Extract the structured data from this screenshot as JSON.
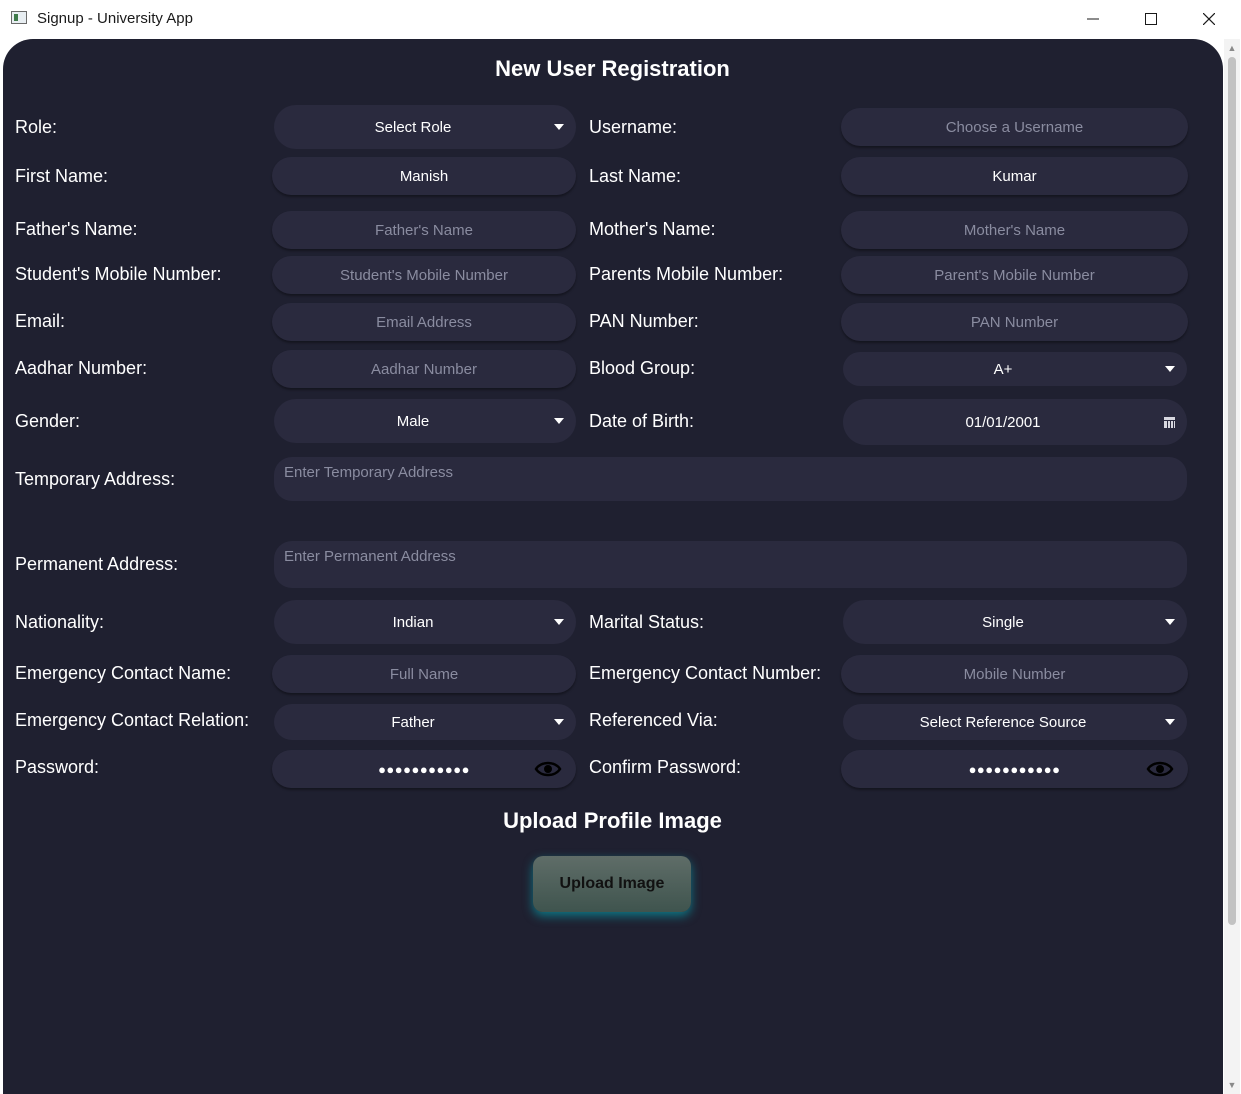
{
  "window": {
    "title": "Signup - University App"
  },
  "form": {
    "heading": "New User Registration",
    "role": {
      "label": "Role:",
      "value": "Select Role"
    },
    "username": {
      "label": "Username:",
      "placeholder": "Choose a Username"
    },
    "first_name": {
      "label": "First Name:",
      "value": "Manish"
    },
    "last_name": {
      "label": "Last Name:",
      "value": "Kumar"
    },
    "father_name": {
      "label": "Father's Name:",
      "placeholder": "Father's Name"
    },
    "mother_name": {
      "label": "Mother's Name:",
      "placeholder": "Mother's Name"
    },
    "student_mobile": {
      "label": "Student's Mobile Number:",
      "placeholder": "Student's Mobile Number"
    },
    "parents_mobile": {
      "label": "Parents Mobile Number:",
      "placeholder": "Parent's Mobile Number"
    },
    "email": {
      "label": "Email:",
      "placeholder": "Email Address"
    },
    "pan": {
      "label": "PAN Number:",
      "placeholder": "PAN Number"
    },
    "aadhar": {
      "label": "Aadhar Number:",
      "placeholder": "Aadhar Number"
    },
    "blood_group": {
      "label": "Blood Group:",
      "value": "A+"
    },
    "gender": {
      "label": "Gender:",
      "value": "Male"
    },
    "dob": {
      "label": "Date of Birth:",
      "value": "01/01/2001"
    },
    "temp_address": {
      "label": "Temporary Address:",
      "placeholder": "Enter Temporary Address"
    },
    "perm_address": {
      "label": "Permanent Address:",
      "placeholder": "Enter Permanent Address"
    },
    "nationality": {
      "label": "Nationality:",
      "value": "Indian"
    },
    "marital_status": {
      "label": "Marital Status:",
      "value": "Single"
    },
    "emergency_name": {
      "label": "Emergency Contact Name:",
      "placeholder": "Full Name"
    },
    "emergency_number": {
      "label": "Emergency Contact Number:",
      "placeholder": "Mobile Number"
    },
    "emergency_relation": {
      "label": "Emergency Contact Relation:",
      "value": "Father"
    },
    "referenced_via": {
      "label": "Referenced Via:",
      "value": "Select Reference Source"
    },
    "password": {
      "label": "Password:",
      "masked": "●●●●●●●●●●●"
    },
    "confirm_password": {
      "label": "Confirm Password:",
      "masked": "●●●●●●●●●●●"
    },
    "upload_heading": "Upload Profile Image",
    "upload_button": "Upload Image"
  },
  "icons": {
    "dropdown": "chevron-down-icon",
    "eye": "eye-icon",
    "calendar": "calendar-icon",
    "minimize": "minimize-icon",
    "maximize": "maximize-icon",
    "close": "close-icon"
  },
  "colors": {
    "background": "#1f2030",
    "field": "#2a2a3e",
    "upload_glow": "#00bec8"
  }
}
